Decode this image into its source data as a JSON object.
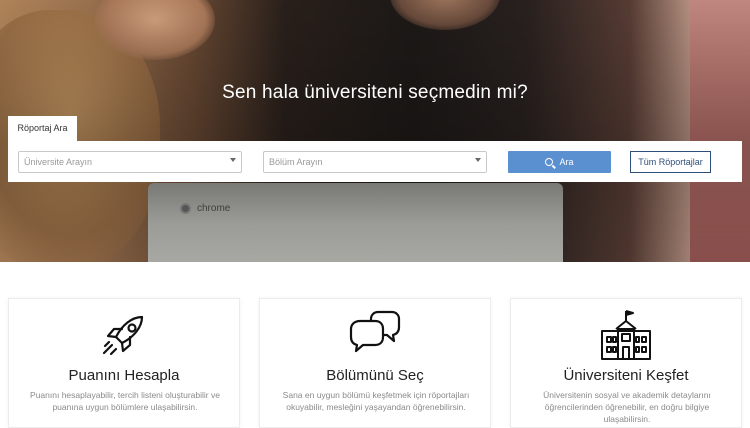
{
  "hero": {
    "headline": "Sen hala üniversiteni seçmedin mi?",
    "laptop_brand": "chrome"
  },
  "search": {
    "tab_label": "Röportaj Ara",
    "university_placeholder": "Üniversite Arayın",
    "department_placeholder": "Bölüm Arayın",
    "search_button": "Ara",
    "all_interviews_button": "Tüm Röportajlar"
  },
  "cards": [
    {
      "icon": "rocket-icon",
      "title": "Puanını Hesapla",
      "description": "Puanını hesaplayabilir, tercih listeni oluşturabilir ve puanına uygun bölümlere ulaşabilirsin."
    },
    {
      "icon": "chat-bubbles-icon",
      "title": "Bölümünü Seç",
      "description": "Sana en uygun bölümü keşfetmek için röportajları okuyabilir, mesleğini yaşayandan öğrenebilirsin."
    },
    {
      "icon": "school-building-icon",
      "title": "Üniversiteni Keşfet",
      "description": "Üniversitenin sosyal ve akademik detaylarını öğrencilerinden öğrenebilir, en doğru bilgiye ulaşabilirsin."
    }
  ],
  "colors": {
    "primary_button": "#5a8fd0",
    "outline_button": "#2f4f7a"
  }
}
